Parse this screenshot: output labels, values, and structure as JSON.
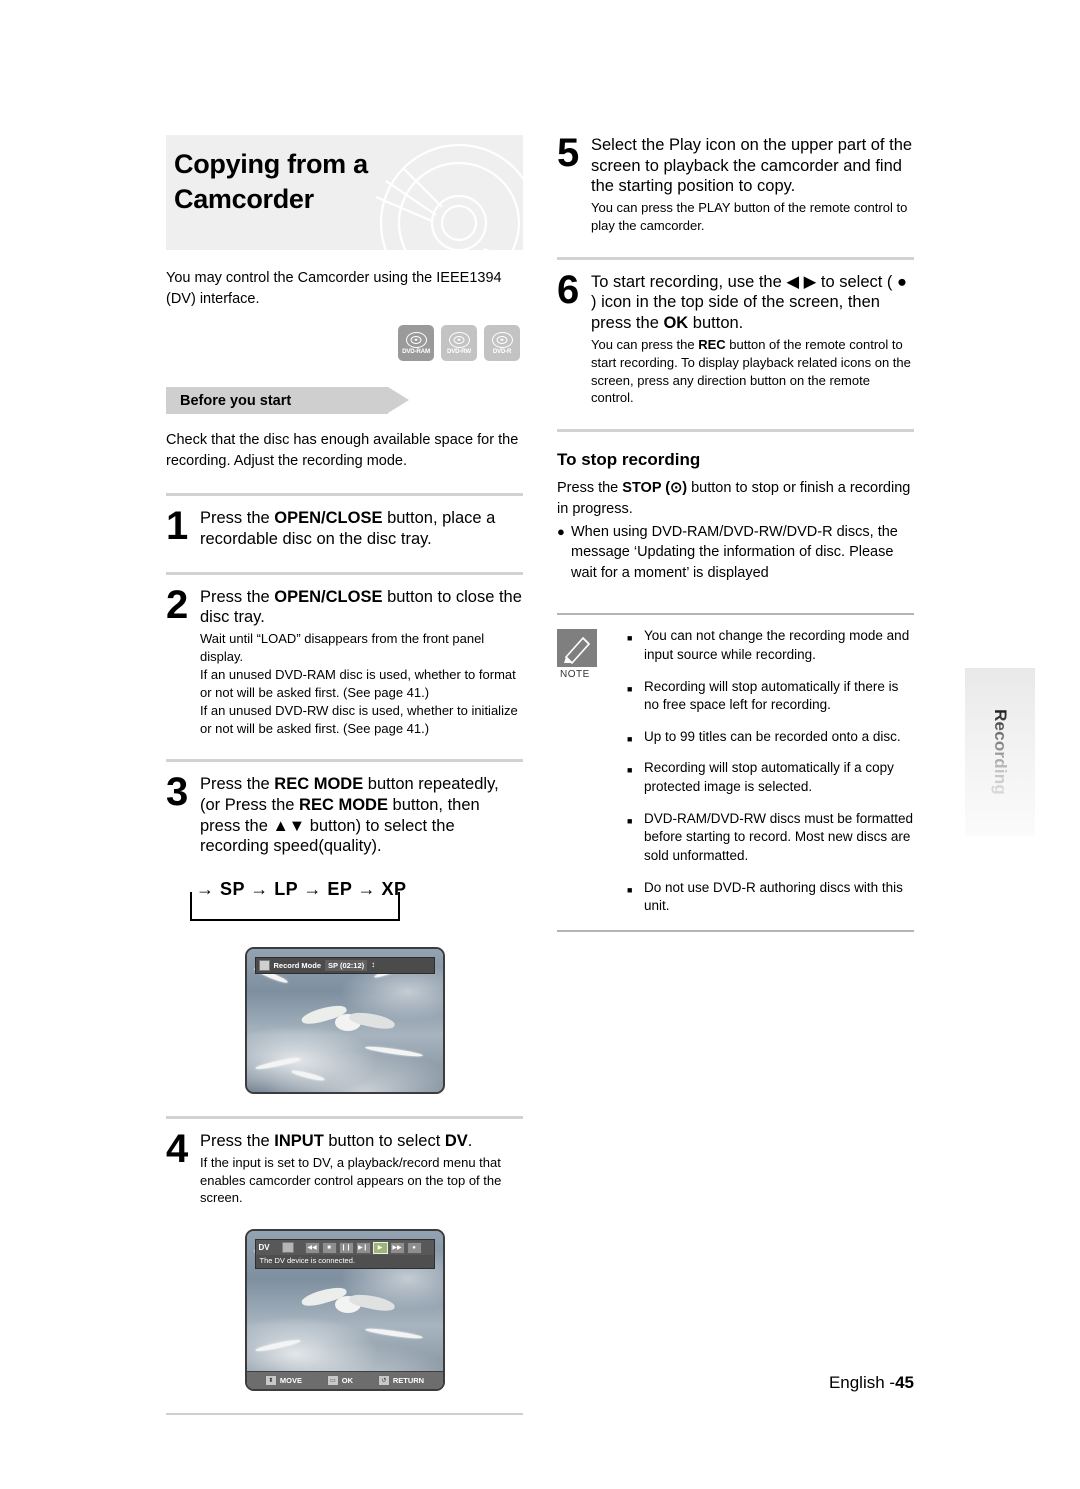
{
  "chapter": {
    "title_line1": "Copying from a",
    "title_line2": "Camcorder",
    "intro": "You may control the Camcorder using the IEEE1394 (DV) interface.",
    "disc_badges": [
      {
        "label": "DVD-RAM",
        "tone": "dark"
      },
      {
        "label": "DVD-RW",
        "tone": "light"
      },
      {
        "label": "DVD-R",
        "tone": "light"
      }
    ],
    "before_you_start_label": "Before you start",
    "before_you_start_body": "Check that the disc has enough available space for the recording. Adjust the recording mode."
  },
  "steps": {
    "s1": {
      "num": "1",
      "main_a": "Press the ",
      "main_b": "OPEN/CLOSE",
      "main_c": " button, place a recordable disc on the disc tray."
    },
    "s2": {
      "num": "2",
      "main_a": "Press the ",
      "main_b": "OPEN/CLOSE",
      "main_c": " button to close the disc tray.",
      "sub1": "Wait until “LOAD” disappears from the front panel display.",
      "sub2": "If an unused DVD-RAM disc is used, whether to format or not will be asked first. (See page 41.)",
      "sub3": "If an unused DVD-RW disc is used, whether to initialize or not will be asked first. (See page 41.)"
    },
    "s3": {
      "num": "3",
      "main_a": "Press the ",
      "main_b": "REC MODE",
      "main_c": " button repeatedly, (or Press the ",
      "main_d": "REC MODE",
      "main_e": " button, then press the ▲▼ button) to select the recording speed(quality).",
      "mode_sequence": "→ SP → LP → EP → XP"
    },
    "s4": {
      "num": "4",
      "main_a": "Press the ",
      "main_b": "INPUT",
      "main_c": " button to select ",
      "main_d": "DV",
      "main_e": ".",
      "sub1": "If the input is set to DV, a playback/record menu that enables camcorder control appears on the top of the screen."
    },
    "s5": {
      "num": "5",
      "main": "Select the Play icon on the upper part of the screen to playback the camcorder and find the starting position to copy.",
      "sub1": "You can press the PLAY button of the remote control to play the camcorder."
    },
    "s6": {
      "num": "6",
      "main_a": "To start recording, use the ◀ ▶ to select ( ● ) icon in the top side of the screen, then press the ",
      "main_b": "OK",
      "main_c": " button.",
      "sub_a": "You can press the ",
      "sub_b": "REC",
      "sub_c": " button of the remote control to start recording. To display playback related icons on the screen, press any direction button on the remote control."
    }
  },
  "tv_recmode": {
    "osd_label": "Record Mode",
    "osd_value": "SP (02:12)",
    "stepper": "↕"
  },
  "tv_dv": {
    "dv_label": "DV",
    "status_text": "The DV device is connected.",
    "controls": [
      {
        "name": "rewind",
        "glyph": "◀◀",
        "selected": false
      },
      {
        "name": "stop",
        "glyph": "■",
        "selected": false
      },
      {
        "name": "pause",
        "glyph": "❙❙",
        "selected": false
      },
      {
        "name": "step-forward",
        "glyph": "▶❙",
        "selected": false
      },
      {
        "name": "play",
        "glyph": "▶",
        "selected": true
      },
      {
        "name": "fast-forward",
        "glyph": "▶▶",
        "selected": false
      },
      {
        "name": "record",
        "glyph": "●",
        "selected": false
      }
    ],
    "bottom_bar": [
      {
        "name": "move",
        "label": "MOVE",
        "icon": "⬍"
      },
      {
        "name": "ok",
        "label": "OK",
        "icon": "▭"
      },
      {
        "name": "return",
        "label": "RETURN",
        "icon": "↺"
      }
    ]
  },
  "stop_recording": {
    "heading": "To stop recording",
    "body_a": "Press the ",
    "body_b": "STOP (⊙)",
    "body_c": " button to stop or finish a recording in progress.",
    "bullet_mark": "●",
    "bullet_text": "When using DVD-RAM/DVD-RW/DVD-R discs, the message ‘Updating the information of disc. Please wait for a moment’ is displayed"
  },
  "note": {
    "label": "NOTE",
    "mark": "■",
    "items": [
      "You can not change the recording mode and input source while recording.",
      "Recording will stop automatically if there is no free space left for recording.",
      "Up to 99 titles can be recorded onto a disc.",
      "Recording will stop automatically if a copy protected image is selected.",
      "DVD-RAM/DVD-RW discs must be formatted before starting to record. Most new discs are sold unformatted.",
      "Do not use DVD-R authoring discs with this unit."
    ]
  },
  "side_tab": {
    "label": "Recording"
  },
  "footer": {
    "language": "English -",
    "page": "45"
  }
}
